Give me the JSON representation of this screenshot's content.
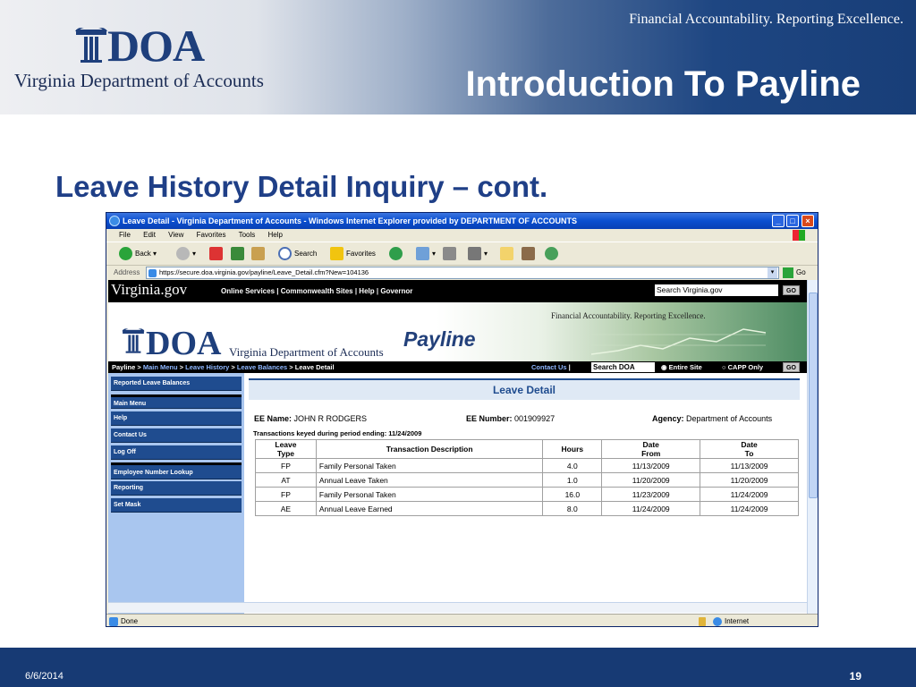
{
  "slide": {
    "logo_word": "DOA",
    "logo_subtitle": "Virginia Department of Accounts",
    "tagline": "Financial Accountability. Reporting Excellence.",
    "title": "Introduction To Payline",
    "subtitle": "Leave History Detail Inquiry – cont.",
    "footer_date": "6/6/2014",
    "page_number": "19",
    "colors": {
      "header_dark": "#183e78",
      "title_blue": "#1f3f87",
      "footer": "#173a74"
    }
  },
  "browser": {
    "window_title": "Leave Detail - Virginia Department of Accounts - Windows Internet Explorer provided by DEPARTMENT OF ACCOUNTS",
    "menu": [
      "File",
      "Edit",
      "View",
      "Favorites",
      "Tools",
      "Help"
    ],
    "toolbar": {
      "back": "Back",
      "search": "Search",
      "favorites": "Favorites"
    },
    "address_label": "Address",
    "url": "https://secure.doa.virginia.gov/payline/Leave_Detail.cfm?New=104136",
    "go_label": "Go",
    "status": "Done",
    "zone": "Internet"
  },
  "site": {
    "vagov_logo": "Virginia.gov",
    "vagov_links": "Online Services | Commonwealth Sites | Help | Governor",
    "vagov_search": "Search Virginia.gov",
    "go": "GO",
    "banner_doa": "DOA",
    "banner_doa_sub": "Virginia Department of Accounts",
    "banner_tagline": "Financial Accountability. Reporting Excellence.",
    "banner_app": "Payline",
    "breadcrumb": {
      "first": "Payline",
      "sep": " > ",
      "main_menu": "Main Menu",
      "leave_history": "Leave History",
      "leave_balances": "Leave Balances",
      "current": "Leave Detail"
    },
    "contact_us": "Contact Us",
    "search_doa": "Search DOA",
    "entire_site": "Entire Site",
    "capp_only": "CAPP Only"
  },
  "nav": {
    "items": [
      "Reported Leave Balances",
      "Main Menu",
      "Help",
      "Contact Us",
      "Log Off",
      "Employee Number Lookup",
      "Reporting",
      "Set Mask"
    ]
  },
  "detail": {
    "heading": "Leave Detail",
    "ee_name_label": "EE Name:",
    "ee_name": "JOHN R RODGERS",
    "ee_number_label": "EE Number:",
    "ee_number": "001909927",
    "agency_label": "Agency:",
    "agency": "Department of Accounts",
    "transactions_label": "Transactions keyed during period ending: 11/24/2009",
    "columns": {
      "leave_1": "Leave",
      "leave_2": "Type",
      "desc": "Transaction Description",
      "hours": "Hours",
      "from_1": "Date",
      "from_2": "From",
      "to_1": "Date",
      "to_2": "To"
    },
    "rows": [
      {
        "type": "FP",
        "desc": "Family Personal Taken",
        "hours": "4.0",
        "from": "11/13/2009",
        "to": "11/13/2009"
      },
      {
        "type": "AT",
        "desc": "Annual Leave Taken",
        "hours": "1.0",
        "from": "11/20/2009",
        "to": "11/20/2009"
      },
      {
        "type": "FP",
        "desc": "Family Personal Taken",
        "hours": "16.0",
        "from": "11/23/2009",
        "to": "11/24/2009"
      },
      {
        "type": "AE",
        "desc": "Annual Leave Earned",
        "hours": "8.0",
        "from": "11/24/2009",
        "to": "11/24/2009"
      }
    ]
  }
}
